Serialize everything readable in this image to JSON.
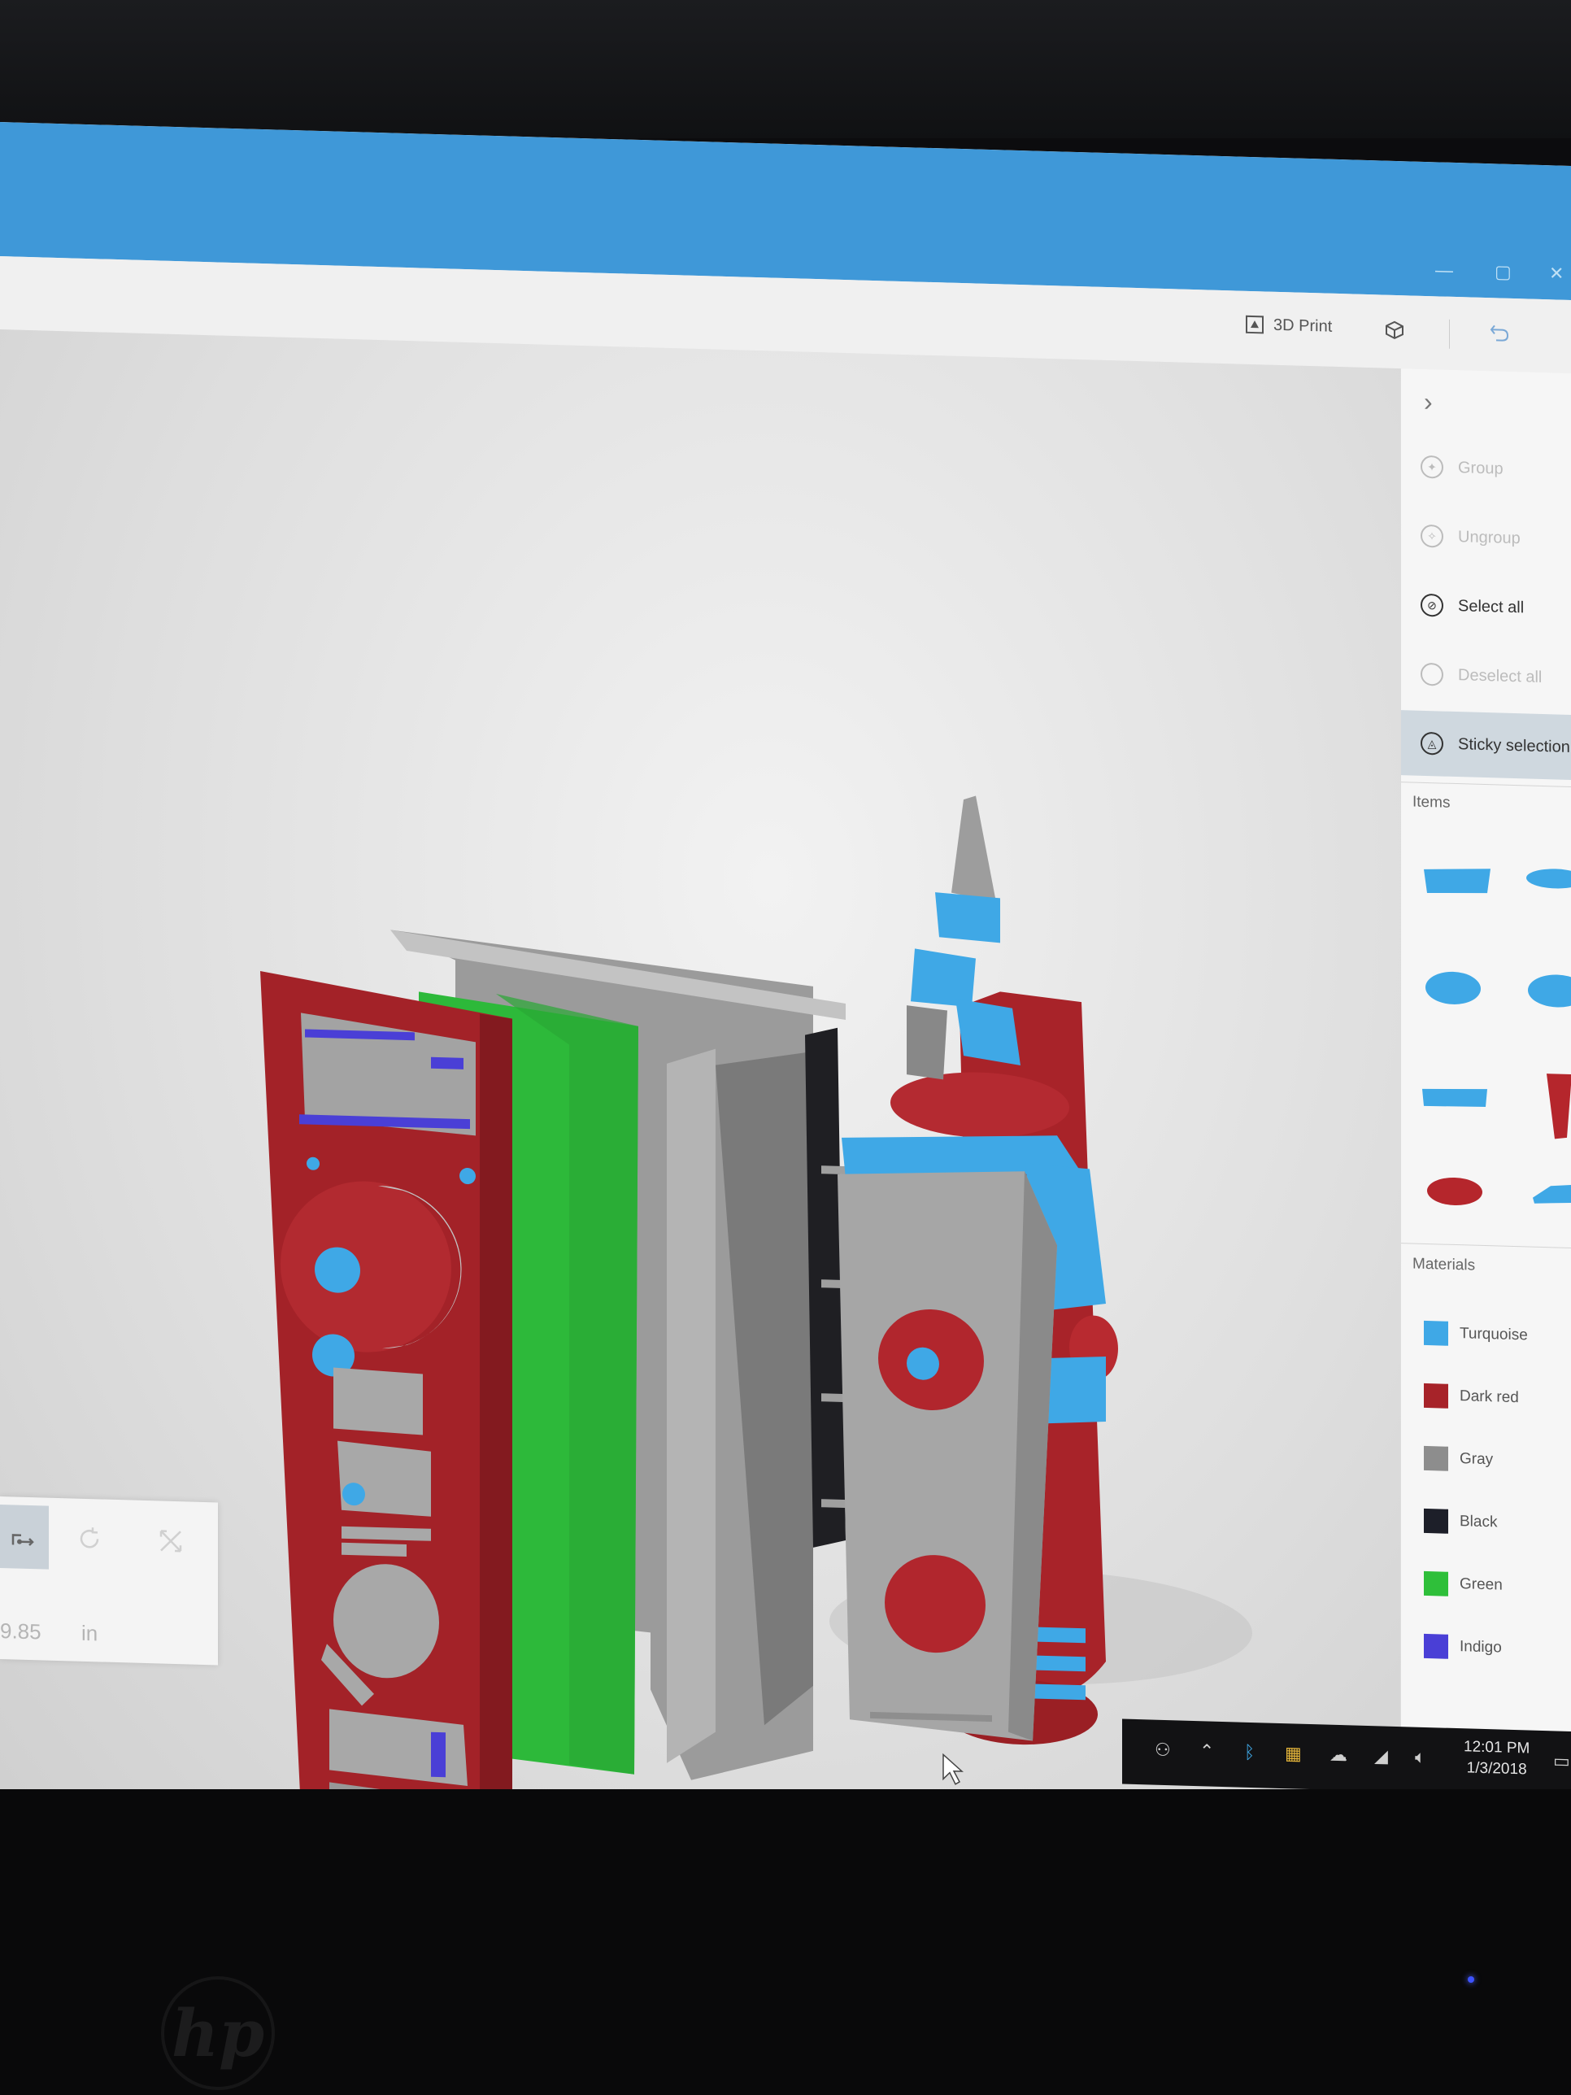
{
  "toolbar": {
    "print_label": "3D Print"
  },
  "panel": {
    "actions": [
      {
        "label": "Group",
        "icon": "group-icon",
        "enabled": false
      },
      {
        "label": "Ungroup",
        "icon": "ungroup-icon",
        "enabled": false
      },
      {
        "label": "Select all",
        "icon": "select-all-icon",
        "enabled": true
      },
      {
        "label": "Deselect all",
        "icon": "deselect-all-icon",
        "enabled": false
      },
      {
        "label": "Sticky selection",
        "icon": "sticky-selection-icon",
        "enabled": true,
        "active": true
      }
    ],
    "items_heading": "Items",
    "items": [
      {
        "shape": "box-slab",
        "color": "#3fa8e6"
      },
      {
        "shape": "disc",
        "color": "#3fa8e6"
      },
      {
        "shape": "ellipse",
        "color": "#3fa8e6"
      },
      {
        "shape": "ellipse",
        "color": "#3fa8e6"
      },
      {
        "shape": "flat-bar",
        "color": "#3fa8e6"
      },
      {
        "shape": "cone-cup",
        "color": "#b5262c"
      },
      {
        "shape": "ellipse",
        "color": "#b5262c"
      },
      {
        "shape": "wedge",
        "color": "#3fa8e6"
      }
    ],
    "materials_heading": "Materials",
    "materials": [
      {
        "label": "Turquoise",
        "color": "#3fa8e6"
      },
      {
        "label": "Dark red",
        "color": "#a72329"
      },
      {
        "label": "Gray",
        "color": "#8d8d8d"
      },
      {
        "label": "Black",
        "color": "#1d1f29"
      },
      {
        "label": "Green",
        "color": "#2fbf3a"
      },
      {
        "label": "Indigo",
        "color": "#4a3fd6"
      }
    ]
  },
  "bottom_panel": {
    "value": "9.85",
    "unit": "in"
  },
  "taskbar": {
    "time": "12:01 PM",
    "date": "1/3/2018"
  },
  "colors": {
    "titlebar": "#3f98d8",
    "accent": "#3fa8e6",
    "dark_red": "#a72329",
    "green": "#2fbf3a"
  }
}
